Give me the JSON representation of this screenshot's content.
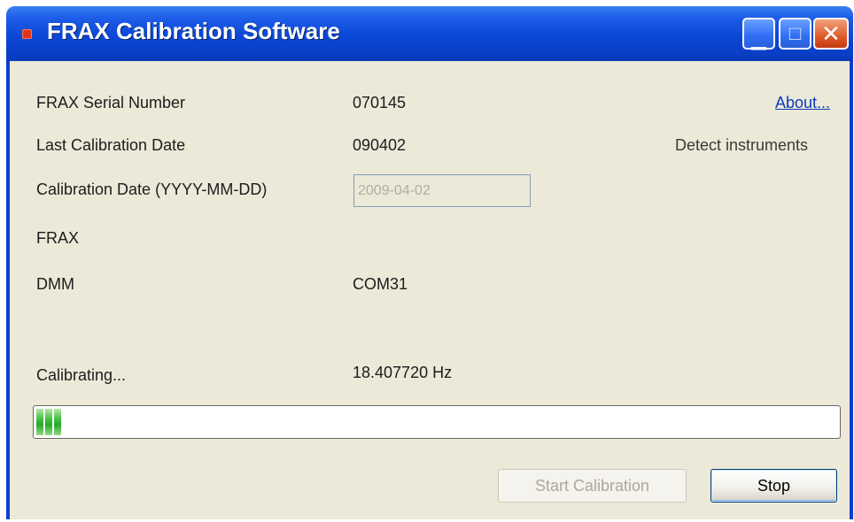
{
  "window": {
    "title": "FRAX Calibration Software",
    "controls": {
      "minimize": "minimize-icon",
      "maximize": "maximize-icon",
      "close": "close-icon"
    }
  },
  "links": {
    "about": "About..."
  },
  "status": {
    "detect_instruments": "Detect instruments"
  },
  "fields": {
    "serial_label": "FRAX Serial Number",
    "serial_value": "070145",
    "last_cal_label": "Last Calibration Date",
    "last_cal_value": "090402",
    "cal_date_label": "Calibration Date (YYYY-MM-DD)",
    "cal_date_value": "2009-04-02",
    "frax_label": "FRAX",
    "dmm_label": "DMM",
    "dmm_value": "COM31",
    "calibrating_label": "Calibrating...",
    "frequency_value": "18.407720 Hz"
  },
  "progress": {
    "percent": 5.2,
    "filled_segments": 3
  },
  "buttons": {
    "start": "Start Calibration",
    "stop": "Stop"
  },
  "colors": {
    "titlebar": "#0b47d6",
    "client_bg": "#ece9d8",
    "progress_fill": "#2fb52f",
    "link": "#0a3bbd"
  }
}
